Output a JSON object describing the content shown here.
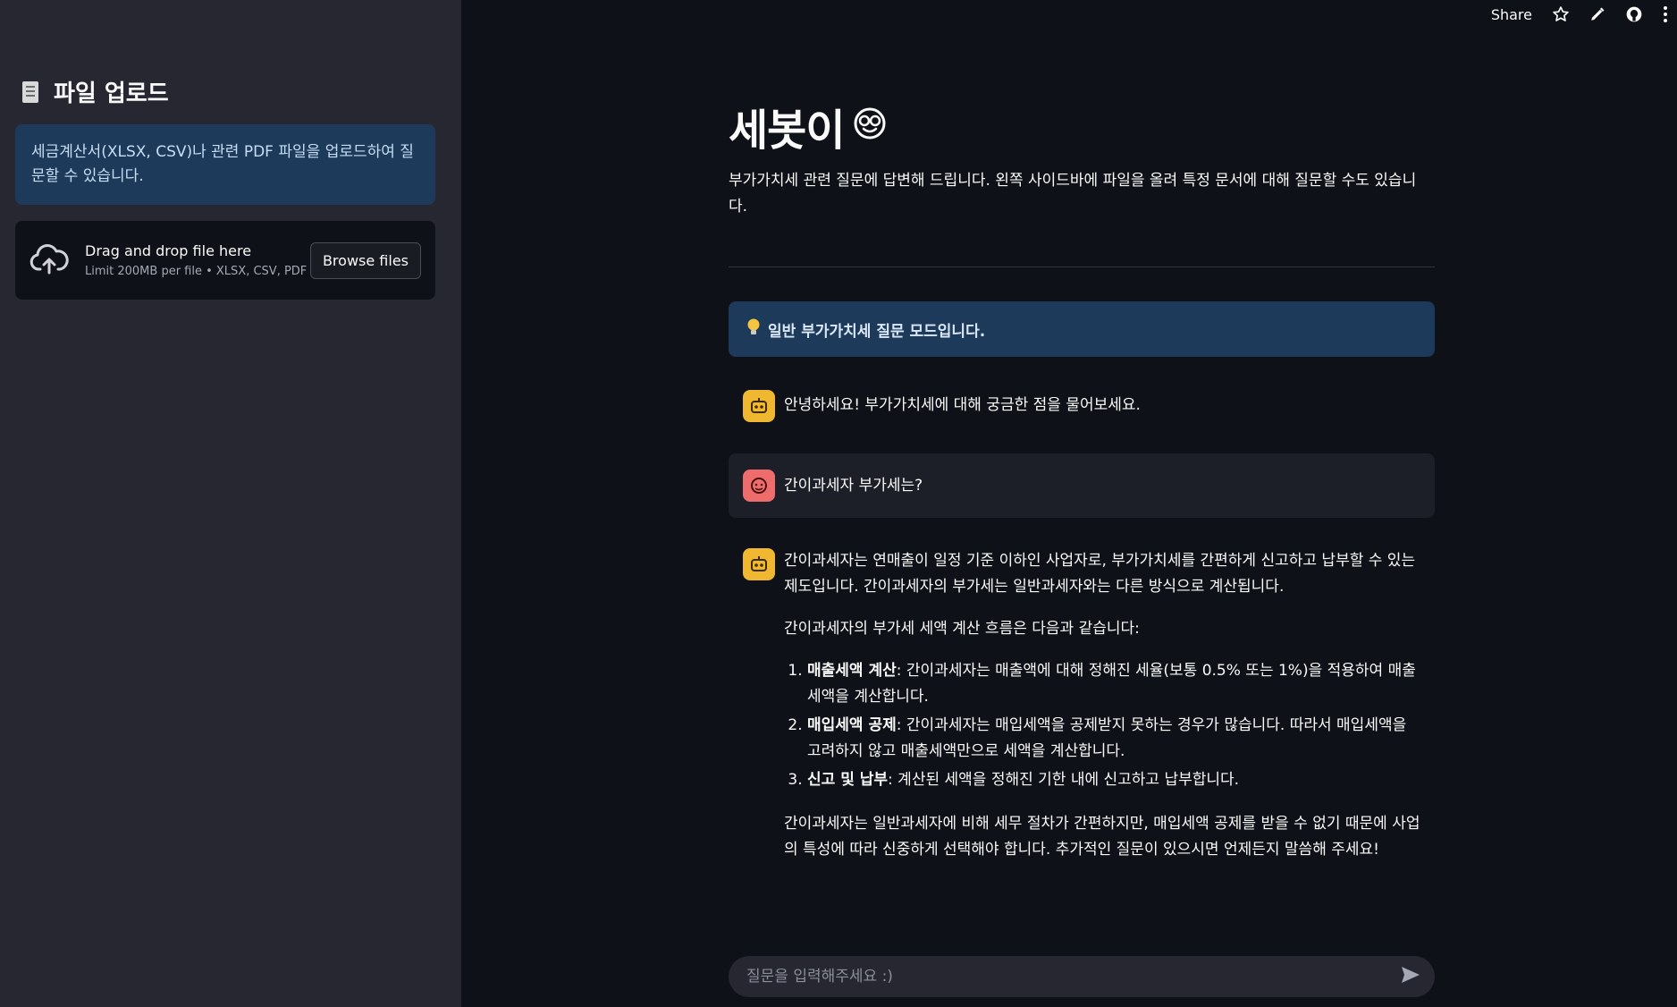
{
  "topbar": {
    "share_label": "Share"
  },
  "sidebar": {
    "header": "파일 업로드",
    "info": "세금계산서(XLSX, CSV)나 관련 PDF 파일을 업로드하여 질문할 수 있습니다.",
    "uploader": {
      "main_text": "Drag and drop file here",
      "sub_text": "Limit 200MB per file • XLSX, CSV, PDF",
      "browse_label": "Browse files"
    }
  },
  "main": {
    "title": "세봇이",
    "subtitle": "부가가치세 관련 질문에 답변해 드립니다. 왼쪽 사이드바에 파일을 올려 특정 문서에 대해 질문할 수도 있습니다.",
    "mode_notice": "일반 부가가치세 질문 모드입니다.",
    "messages": {
      "greeting": "안녕하세요! 부가가치세에 대해 궁금한 점을 물어보세요.",
      "user_question": "간이과세자 부가세는?",
      "answer": {
        "intro": "간이과세자는 연매출이 일정 기준 이하인 사업자로, 부가가치세를 간편하게 신고하고 납부할 수 있는 제도입니다. 간이과세자의 부가세는 일반과세자와는 다른 방식으로 계산됩니다.",
        "flow_intro": "간이과세자의 부가세 세액 계산 흐름은 다음과 같습니다:",
        "steps": [
          {
            "title": "매출세액 계산",
            "text": ": 간이과세자는 매출액에 대해 정해진 세율(보통 0.5% 또는 1%)을 적용하여 매출세액을 계산합니다."
          },
          {
            "title": "매입세액 공제",
            "text": ": 간이과세자는 매입세액을 공제받지 못하는 경우가 많습니다. 따라서 매입세액을 고려하지 않고 매출세액만으로 세액을 계산합니다."
          },
          {
            "title": "신고 및 납부",
            "text": ": 계산된 세액을 정해진 기한 내에 신고하고 납부합니다."
          }
        ],
        "closing": "간이과세자는 일반과세자에 비해 세무 절차가 간편하지만, 매입세액 공제를 받을 수 없기 때문에 사업의 특성에 따라 신중하게 선택해야 합니다. 추가적인 질문이 있으시면 언제든지 말씀해 주세요!"
      }
    }
  },
  "chat_input": {
    "placeholder": "질문을 입력해주세요 :)"
  },
  "colors": {
    "background": "#0e1117",
    "sidebar": "#262730",
    "info_box": "#1e3a5a",
    "bot_avatar": "#f0b730",
    "user_avatar": "#ef6c6c"
  },
  "icons": {
    "sidebar_header": "document-icon",
    "uploader": "cloud-upload-icon",
    "title": "nerd-face-icon",
    "mode": "lightbulb-icon",
    "bot": "robot-icon",
    "user": "user-face-icon",
    "send": "send-icon",
    "topbar": [
      "star-icon",
      "pencil-icon",
      "github-icon",
      "kebab-menu-icon"
    ]
  }
}
